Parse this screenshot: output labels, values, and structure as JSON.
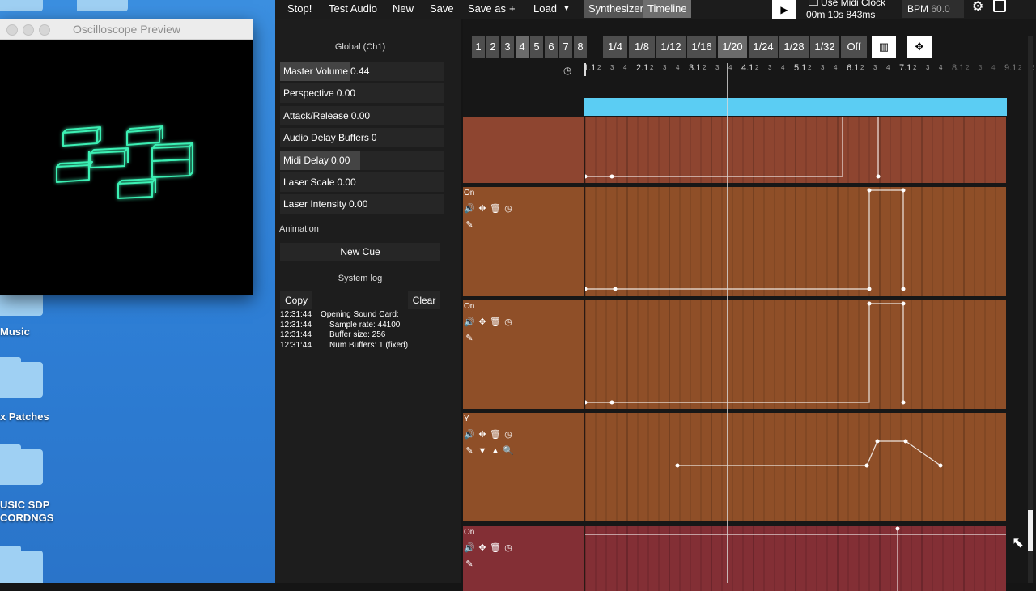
{
  "desktop": {
    "folders": [
      {
        "label": ""
      },
      {
        "label": "Music"
      },
      {
        "label": "x Patches"
      },
      {
        "label": "USIC SDP\nCORDNGS"
      },
      {
        "label": ""
      }
    ]
  },
  "oscilloscope": {
    "title": "Oscilloscope Preview",
    "trace_color": "#3cf0b4"
  },
  "toolbar": {
    "stop": "Stop!",
    "test_audio": "Test Audio",
    "new": "New",
    "save": "Save",
    "save_as": "Save as",
    "plus": "+",
    "load": "Load",
    "synthesizer": "Synthesizer",
    "timeline": "Timeline",
    "use_midi_clock": "Use Midi Clock",
    "time": "00m 10s 843ms",
    "bpm_label": "BPM",
    "bpm_value": "60.0"
  },
  "global": {
    "header": "Global (Ch1)",
    "params": [
      {
        "label": "Master Volume",
        "value": "0.44",
        "level": 0.44
      },
      {
        "label": "Perspective",
        "value": "0.00",
        "level": 0
      },
      {
        "label": "Attack/Release",
        "value": "0.00",
        "level": 0
      },
      {
        "label": "Audio Delay Buffers",
        "value": "0",
        "level": 0
      },
      {
        "label": "Midi Delay",
        "value": "0.00",
        "level": 0.5
      },
      {
        "label": "Laser Scale",
        "value": "0.00",
        "level": 0
      },
      {
        "label": "Laser Intensity",
        "value": "0.00",
        "level": 0
      }
    ],
    "animation_label": "Animation",
    "new_cue": "New Cue",
    "system_log": "System log",
    "copy": "Copy",
    "clear": "Clear",
    "log": [
      {
        "time": "12:31:44",
        "text": "Opening Sound Card:"
      },
      {
        "time": "12:31:44",
        "text": "    Sample rate: 44100"
      },
      {
        "time": "12:31:44",
        "text": "    Buffer size: 256"
      },
      {
        "time": "12:31:44",
        "text": "    Num Buffers: 1 (fixed)"
      }
    ]
  },
  "zoom": {
    "bars": [
      "1",
      "2",
      "3",
      "4",
      "5",
      "6",
      "7",
      "8"
    ],
    "selected_bar": "4",
    "subdivisions": [
      "1/4",
      "1/8",
      "1/12",
      "1/16",
      "1/20",
      "1/24",
      "1/28",
      "1/32",
      "Off"
    ],
    "selected_subdivision": "1/20"
  },
  "ruler": {
    "major": [
      "1.1",
      "2.1",
      "3.1",
      "4.1",
      "5.1",
      "6.1",
      "7.1",
      "8.1",
      "9.1"
    ],
    "minor": [
      "2",
      "3",
      "4"
    ]
  },
  "tracks": [
    {
      "label": "",
      "color": "#8e4530"
    },
    {
      "label": "On",
      "color": "#8f4f28"
    },
    {
      "label": "On",
      "color": "#8f4f28"
    },
    {
      "label": "Y",
      "color": "#8f4f28"
    },
    {
      "label": "On",
      "color": "#832f35"
    }
  ],
  "colors": {
    "progress": "#5bcdf3",
    "playhead": "#d8d8d8"
  }
}
